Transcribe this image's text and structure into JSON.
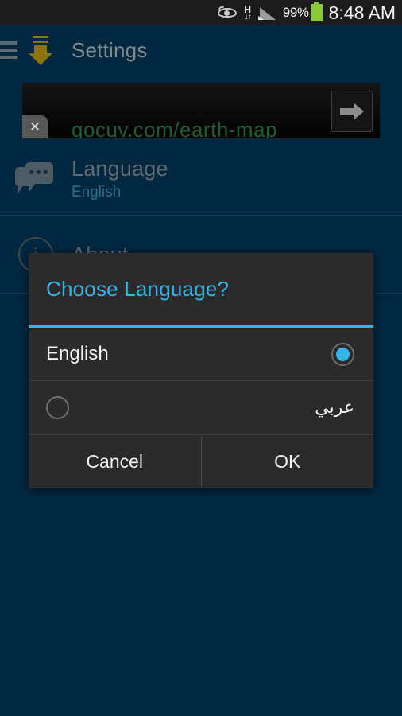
{
  "status_bar": {
    "eye_icon": "eye-icon",
    "network_label": "H",
    "network_arrows": "↓↑",
    "signal_icon": "signal-bars-icon",
    "battery_percent": "99%",
    "battery_icon": "battery-full-icon",
    "time": "8:48 AM"
  },
  "action_bar": {
    "menu_icon": "hamburger-menu-icon",
    "logo_icon": "download-arrow-logo",
    "title": "Settings"
  },
  "ad_banner": {
    "text": "gocuv.com/earth-map",
    "close_label": "✕",
    "arrow_icon": "arrow-right-icon"
  },
  "settings": {
    "rows": [
      {
        "icon": "chat-bubble-icon",
        "title": "Language",
        "subtitle": "English"
      },
      {
        "icon": "info-circle-icon",
        "title": "About",
        "subtitle": ""
      }
    ]
  },
  "dialog": {
    "title": "Choose Language?",
    "options": [
      {
        "label": "English",
        "selected": true,
        "rtl": false
      },
      {
        "label": "عربي",
        "selected": false,
        "rtl": true
      }
    ],
    "cancel_label": "Cancel",
    "ok_label": "OK"
  },
  "colors": {
    "background": "#022840",
    "accent_blue": "#33b5e5",
    "dialog_bg": "#2b2b2b",
    "status_bar_bg": "#1c1c1c",
    "logo_gold": "#8a7308",
    "battery_green": "#8cc63f",
    "ad_text_green": "#1f5c33"
  }
}
